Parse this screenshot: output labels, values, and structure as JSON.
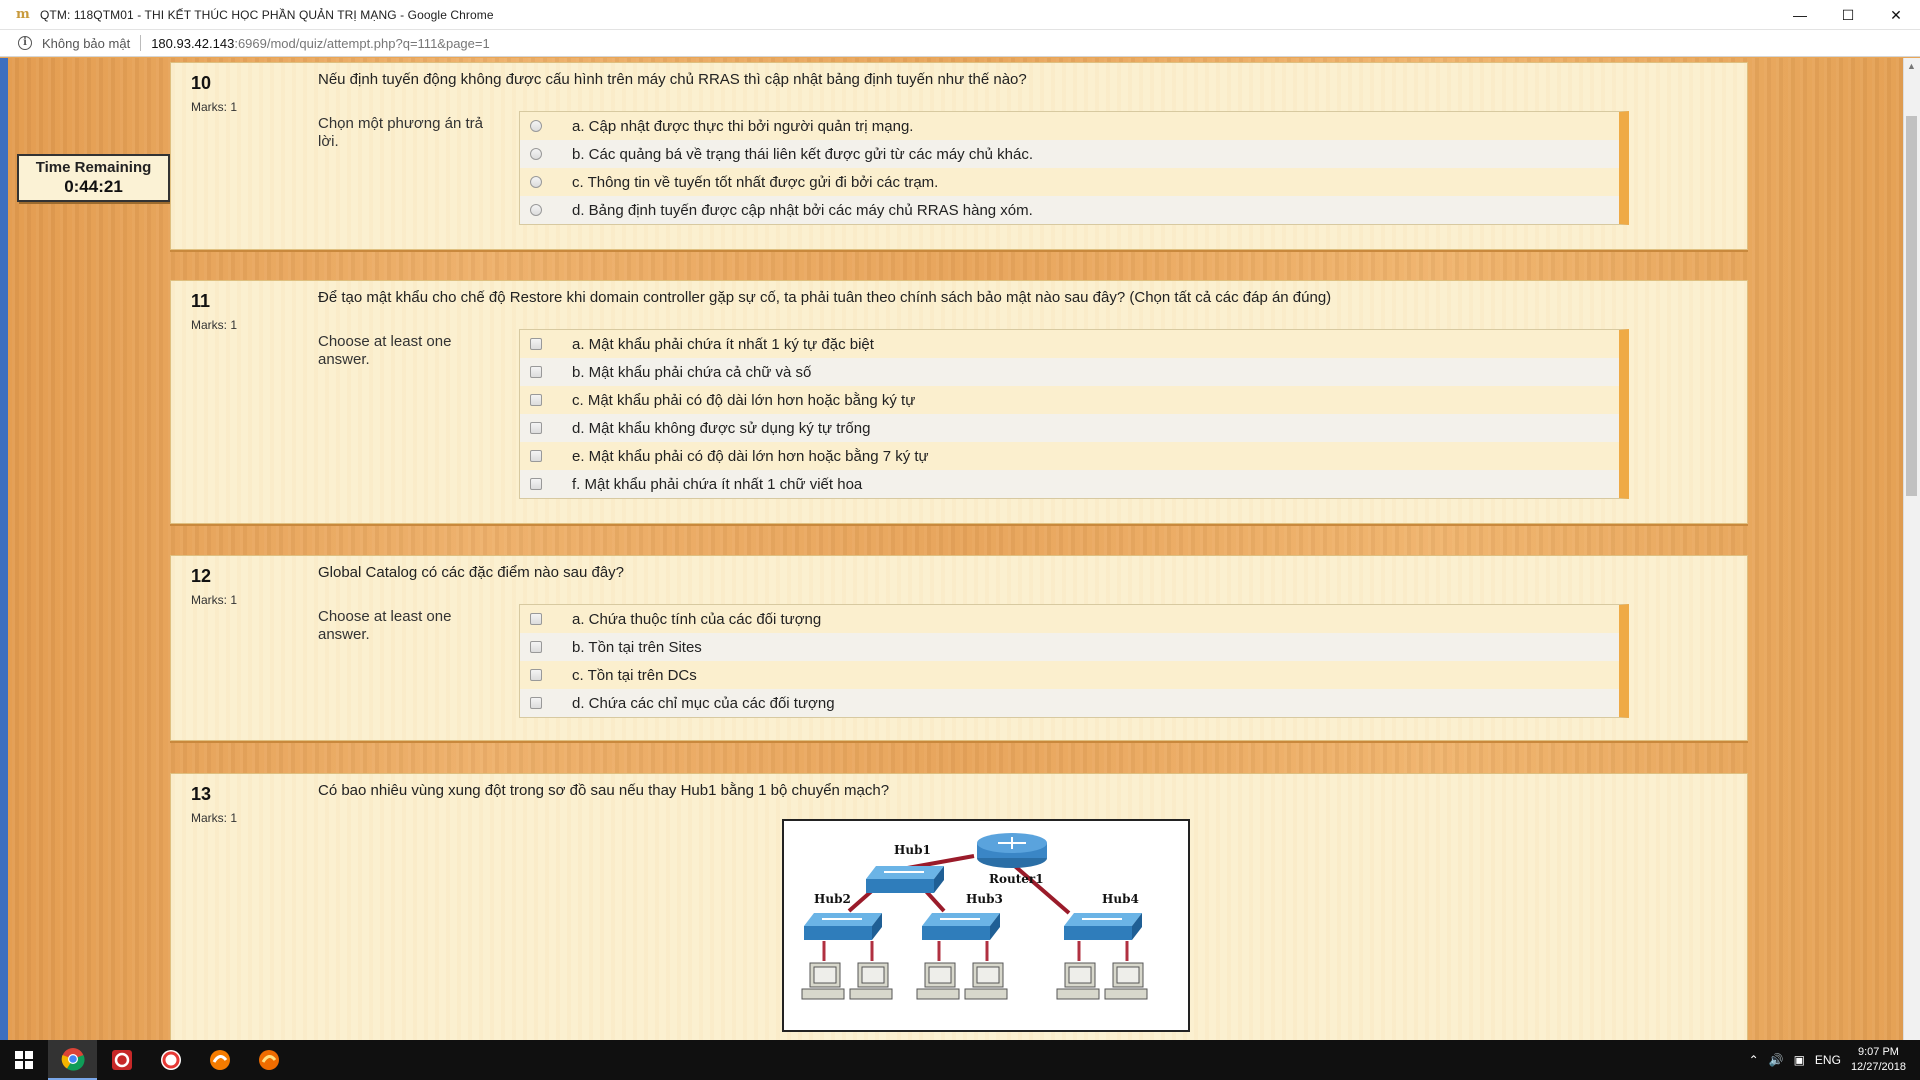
{
  "window": {
    "title": "QTM: 118QTM01 - THI KẾT THÚC HỌC PHẦN QUẢN TRỊ MẠNG - Google Chrome",
    "app_icon_glyph": "m"
  },
  "addressbar": {
    "security_label": "Không bảo mật",
    "host": "180.93.42.143",
    "path": ":6969/mod/quiz/attempt.php?q=111&page=1"
  },
  "timer": {
    "label": "Time Remaining",
    "value": "0:44:21"
  },
  "questions": [
    {
      "number": "10",
      "marks": "Marks: 1",
      "text": "Nếu định tuyến động không được cấu hình trên máy chủ RRAS thì cập nhật bảng định tuyến như thế nào?",
      "prompt": "Chọn một phương án trả lời.",
      "input_type": "radio",
      "options": [
        "a. Cập nhật được thực thi bởi người quản trị mạng.",
        "b. Các quảng bá về trạng thái liên kết được gửi từ các máy chủ khác.",
        "c. Thông tin về tuyến tốt nhất được gửi đi bởi các trạm.",
        "d. Bảng định tuyến được cập nhật bởi các máy chủ RRAS hàng xóm."
      ]
    },
    {
      "number": "11",
      "marks": "Marks: 1",
      "text": "Để tạo mật khẩu cho chế độ Restore khi domain controller gặp sự cố, ta phải tuân theo chính sách bảo mật nào sau đây? (Chọn tất cả các đáp án đúng)",
      "prompt": "Choose at least one answer.",
      "input_type": "checkbox",
      "options": [
        "a. Mật khẩu phải chứa ít nhất 1 ký tự đặc biệt",
        "b. Mật khẩu phải chứa cả chữ và số",
        "c. Mật khẩu phải có độ dài lớn hơn hoặc bằng ký tự",
        "d. Mật khẩu không được sử dụng ký tự trống",
        "e. Mật khẩu phải có độ dài lớn hơn hoặc bằng 7 ký tự",
        "f. Mật khẩu phải chứa ít nhất 1 chữ viết hoa"
      ]
    },
    {
      "number": "12",
      "marks": "Marks: 1",
      "text": "Global Catalog có các đặc điểm nào sau đây?",
      "prompt": "Choose at least one answer.",
      "input_type": "checkbox",
      "options": [
        "a. Chứa thuộc tính của các đối tượng",
        "b. Tồn tại trên Sites",
        "c. Tồn tại trên DCs",
        "d. Chứa các chỉ mục của các đối tượng"
      ]
    },
    {
      "number": "13",
      "marks": "Marks: 1",
      "text": "Có bao nhiêu vùng xung đột trong sơ đồ sau nếu thay Hub1 bằng 1 bộ chuyển mạch?",
      "diagram_labels": {
        "hub1": "Hub1",
        "router": "Router1",
        "hub2": "Hub2",
        "hub3": "Hub3",
        "hub4": "Hub4"
      }
    }
  ],
  "taskbar": {
    "apps": [
      "chrome-icon",
      "app-red-icon",
      "app-circle-icon",
      "app-flame-icon",
      "app-flame-icon-2"
    ],
    "language": "ENG",
    "time": "9:07 PM",
    "date": "12/27/2018"
  }
}
